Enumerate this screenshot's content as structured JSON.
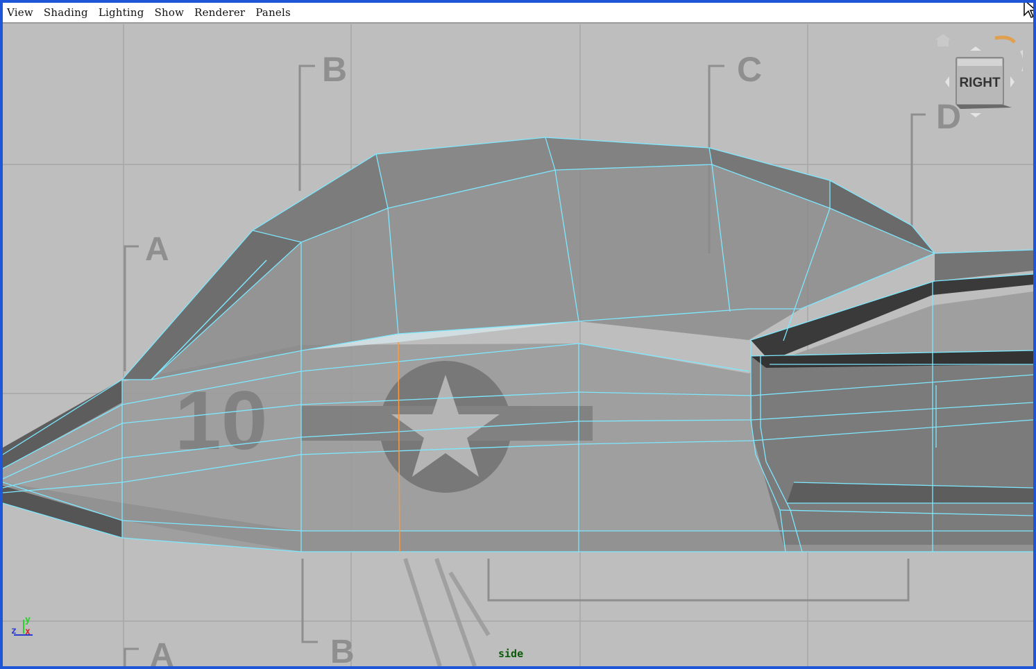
{
  "menubar": {
    "items": [
      {
        "label": "View"
      },
      {
        "label": "Shading"
      },
      {
        "label": "Lighting"
      },
      {
        "label": "Show"
      },
      {
        "label": "Renderer"
      },
      {
        "label": "Panels"
      }
    ]
  },
  "viewport": {
    "camera": "side",
    "viewcube_face": "RIGHT",
    "axis_x": "X",
    "axis_y": "Y",
    "axis_z": "Z"
  },
  "blueprint": {
    "section_labels": [
      "B",
      "C",
      "D",
      "A",
      "A",
      "B"
    ],
    "nose_number": "10"
  },
  "colors": {
    "frame_border": "#1f56d8",
    "viewport_bg": "#bdbdbd",
    "wireframe": "#7ee8ff",
    "camera_label": "#0a5a0a"
  },
  "icons": [
    "home-icon",
    "orbit-arrow-icon",
    "mouse-cursor-icon",
    "axis-gizmo-icon"
  ]
}
